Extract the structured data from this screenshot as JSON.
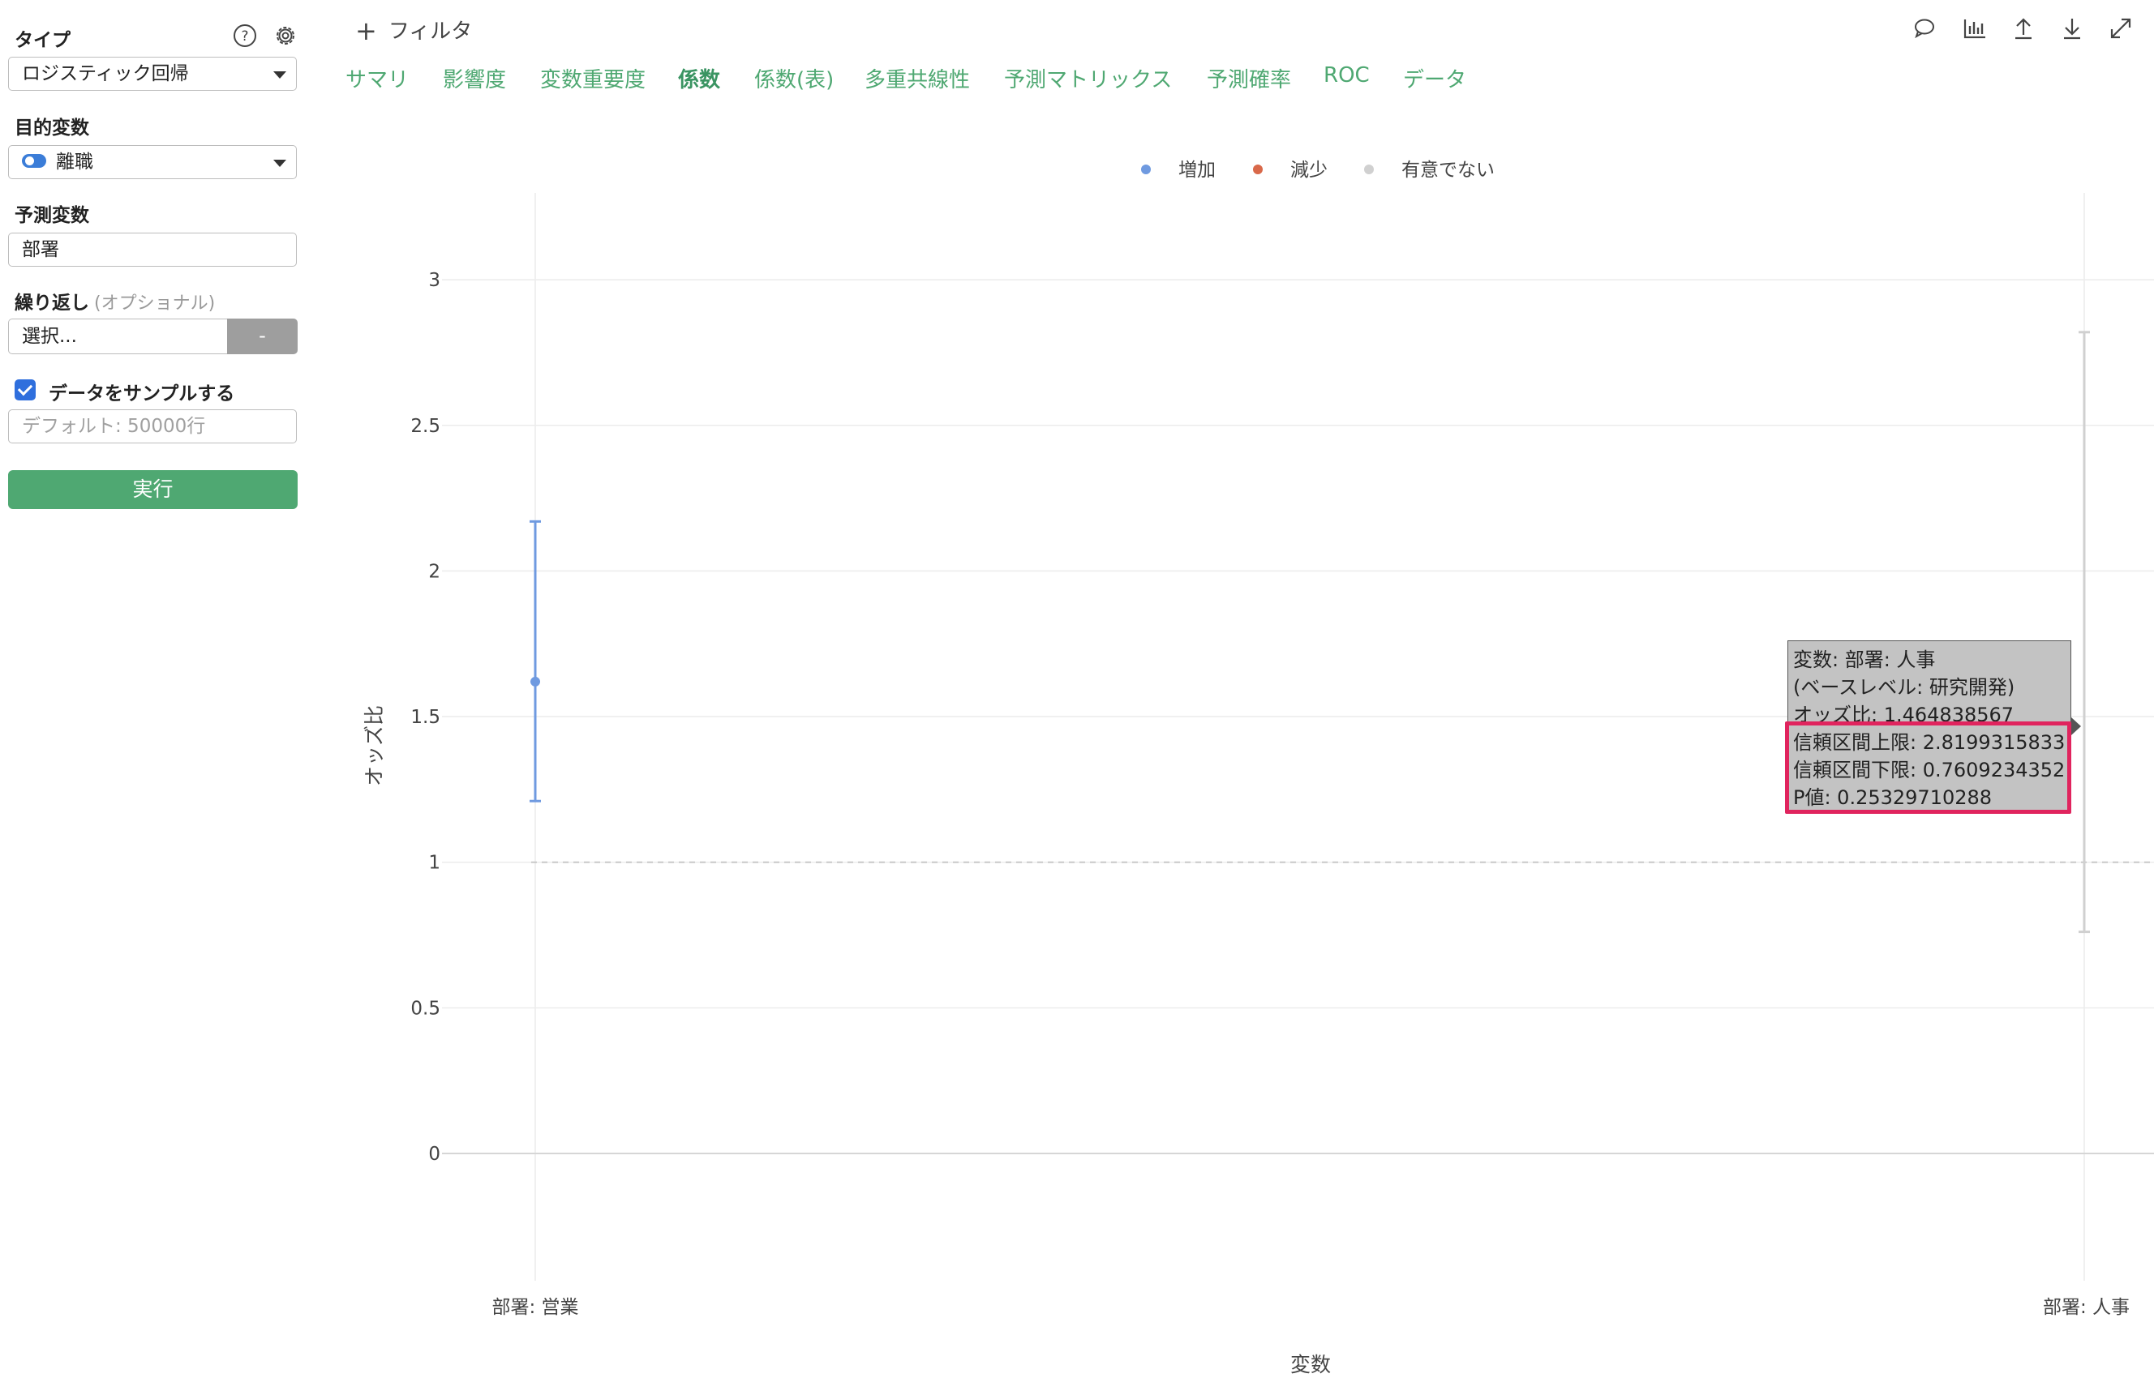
{
  "sidebar": {
    "type_label": "タイプ",
    "type_value": "ロジスティック回帰",
    "target_label": "目的変数",
    "target_value": "離職",
    "predictor_label": "予測変数",
    "predictor_value": "部署",
    "repeat_label": "繰り返し",
    "repeat_optional": "(オプショナル)",
    "repeat_placeholder": "選択...",
    "repeat_button": "-",
    "sample_label": "データをサンプルする",
    "sample_checked": true,
    "sample_placeholder": "デフォルト: 50000行",
    "run_button": "実行"
  },
  "topbar": {
    "filter_label": "フィルタ",
    "icons": [
      "comment-icon",
      "chart-icon",
      "upload-icon",
      "download-icon",
      "expand-icon"
    ]
  },
  "tabs": [
    {
      "label": "サマリ",
      "active": false
    },
    {
      "label": "影響度",
      "active": false
    },
    {
      "label": "変数重要度",
      "active": false
    },
    {
      "label": "係数",
      "active": true
    },
    {
      "label": "係数(表)",
      "active": false
    },
    {
      "label": "多重共線性",
      "active": false
    },
    {
      "label": "予測マトリックス",
      "active": false
    },
    {
      "label": "予測確率",
      "active": false
    },
    {
      "label": "ROC",
      "active": false
    },
    {
      "label": "データ",
      "active": false
    }
  ],
  "chart_data": {
    "type": "scatter",
    "xlabel": "変数",
    "ylabel": "オッズ比",
    "categories": [
      "部署: 営業",
      "部署: 人事"
    ],
    "ylim": [
      -0.45,
      3.3
    ],
    "yticks": [
      "0",
      "0.5",
      "1",
      "1.5",
      "2",
      "2.5",
      "3"
    ],
    "reference_line": 1,
    "legend": [
      {
        "name": "増加",
        "color": "#6f9ae0"
      },
      {
        "name": "減少",
        "color": "#d9694a"
      },
      {
        "name": "有意でない",
        "color": "#d0d0d0"
      }
    ],
    "legend_position": "top-center",
    "points": [
      {
        "category": "部署: 営業",
        "odds_ratio": 1.62,
        "ci_lower": 1.21,
        "ci_upper": 2.17,
        "group": "増加",
        "color": "#6f9ae0"
      },
      {
        "category": "部署: 人事",
        "odds_ratio": 1.464838567,
        "ci_lower": 0.7609234352,
        "ci_upper": 2.8199315833,
        "group": "有意でない",
        "color": "#d0d0d0"
      }
    ]
  },
  "tooltip": {
    "lines": [
      "変数: 部署: 人事",
      "(ベースレベル: 研究開発)",
      "オッズ比: 1.464838567",
      "信頼区間上限: 2.8199315833",
      "信頼区間下限: 0.7609234352",
      "P値: 0.25329710288"
    ]
  }
}
